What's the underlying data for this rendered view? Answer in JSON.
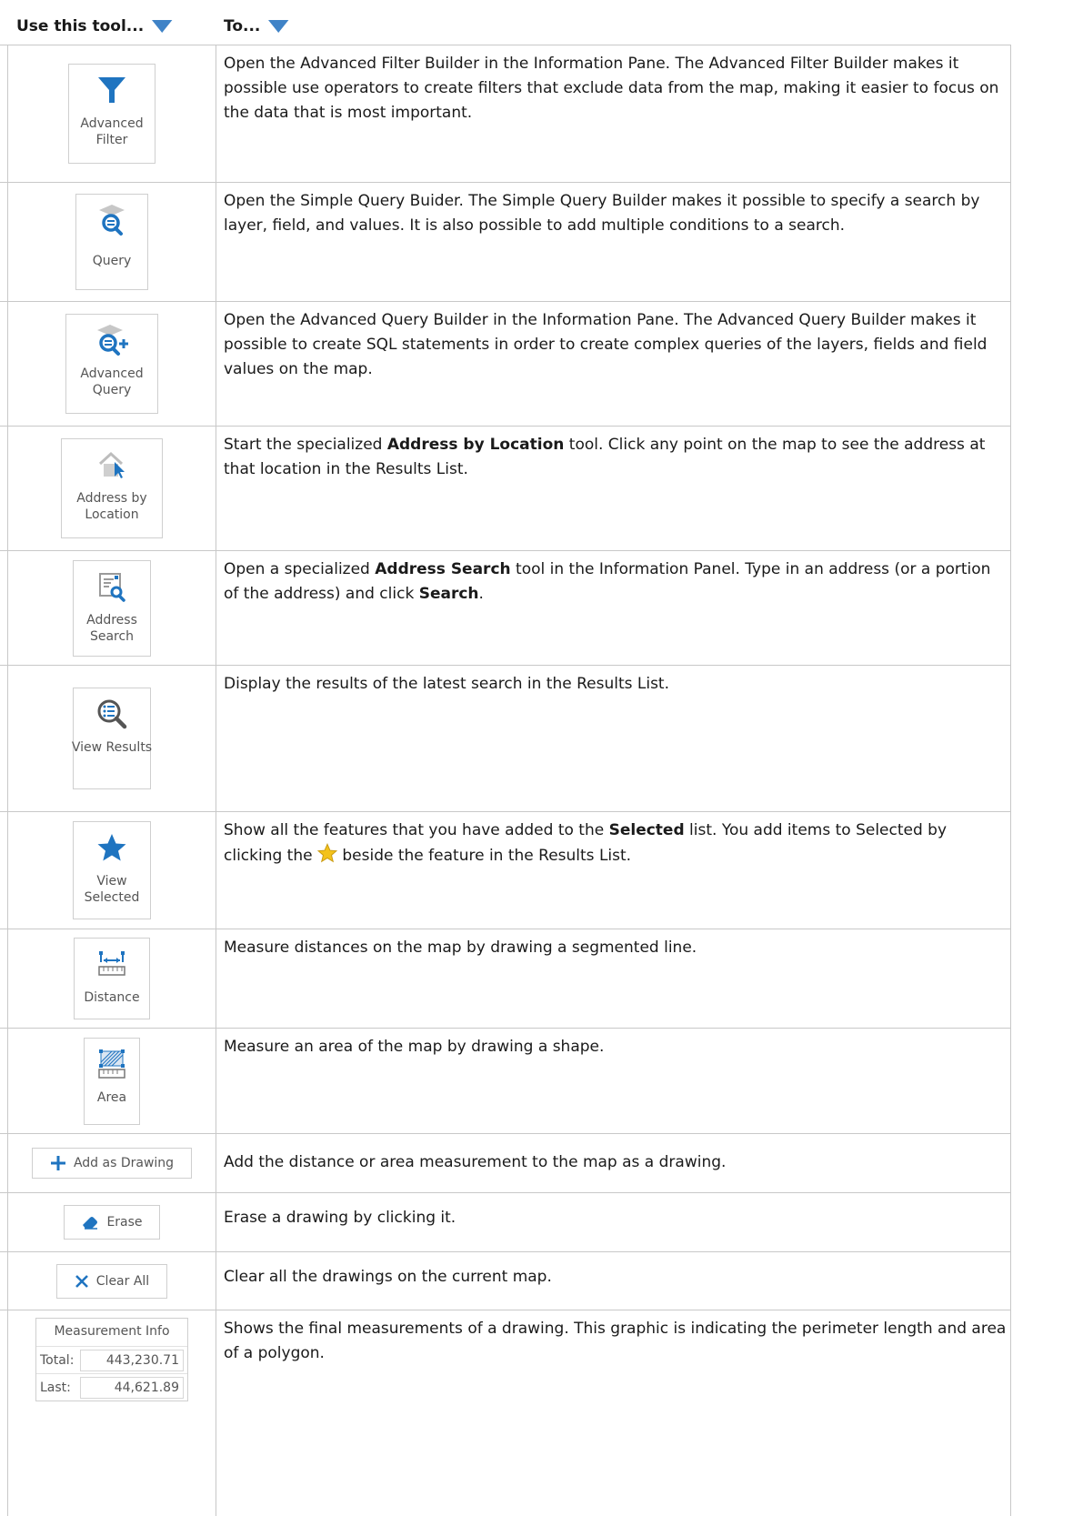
{
  "header": {
    "tool": "Use this tool...",
    "to": "To..."
  },
  "rows": [
    {
      "tool_label": "Advanced Filter",
      "icon": "filter-icon",
      "desc": "Open the Advanced Filter Builder in the Information Pane. The Advanced Filter Builder makes it possible use operators to create filters that exclude data from the map, making it easier to focus on the data that is most important."
    },
    {
      "tool_label": "Query",
      "icon": "query-icon",
      "desc": "Open the Simple Query Buider. The Simple Query Builder makes it possible to specify a search by layer, field, and values. It is also possible to add multiple conditions to a search."
    },
    {
      "tool_label": "Advanced Query",
      "icon": "advanced-query-icon",
      "desc": "Open the Advanced Query Builder in the Information Pane. The Advanced Query Builder makes it possible to create SQL statements in order to create complex queries of the layers, fields and field values on the map."
    },
    {
      "tool_label": "Address by Location",
      "icon": "address-by-location-icon",
      "desc_pre": "Start the specialized ",
      "desc_bold": "Address by Location",
      "desc_post": " tool. Click any point on the map to see the address at that location in the Results List."
    },
    {
      "tool_label": "Address Search",
      "icon": "address-search-icon",
      "desc_pre": "Open a specialized ",
      "desc_bold": "Address Search",
      "desc_mid": " tool in the Information Panel. Type in an address (or a portion of the address) and click ",
      "desc_bold2": "Search",
      "desc_post": "."
    },
    {
      "tool_label": "View Results",
      "icon": "view-results-icon",
      "desc": "Display the results of the latest search in the Results List."
    },
    {
      "tool_label": "View Selected",
      "icon": "star-icon",
      "desc_pre": "Show all the features that you have added to the ",
      "desc_bold": "Selected",
      "desc_mid": " list. You add items to Selected by clicking the ",
      "desc_post": " beside the feature in the Results List."
    },
    {
      "tool_label": "Distance",
      "icon": "distance-icon",
      "desc": "Measure distances on the map by drawing a segmented line."
    },
    {
      "tool_label": "Area",
      "icon": "area-icon",
      "desc": "Measure an area of the map by drawing a shape."
    },
    {
      "tool_label": "Add as Drawing",
      "icon": "plus-icon",
      "desc": "Add the distance or area measurement to the map as a drawing."
    },
    {
      "tool_label": "Erase",
      "icon": "eraser-icon",
      "desc": "Erase a drawing by clicking it."
    },
    {
      "tool_label": "Clear All",
      "icon": "close-icon",
      "desc": "Clear all the drawings on the current map."
    },
    {
      "tool_label": "Measurement Info",
      "icon": "",
      "total_label": "Total:",
      "total_value": "443,230.71",
      "last_label": "Last:",
      "last_value": "44,621.89",
      "desc": "Shows the final measurements of a drawing. This graphic is indicating the perimeter length and area of a polygon."
    }
  ],
  "colors": {
    "accent": "#1f74c0",
    "border": "#c8c8c8",
    "star": "#f3c21b"
  }
}
